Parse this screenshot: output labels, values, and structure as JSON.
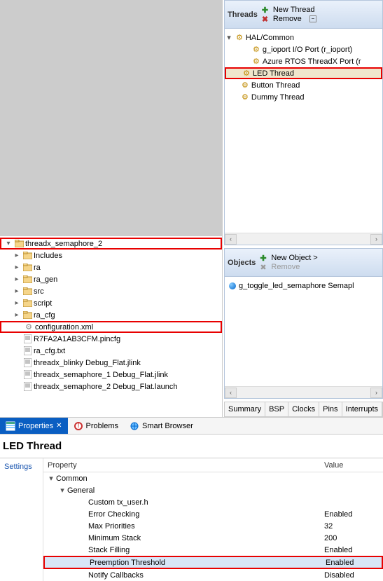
{
  "project_tree": {
    "root": "threadx_semaphore_2",
    "children": [
      {
        "label": "Includes",
        "type": "folder-inc"
      },
      {
        "label": "ra",
        "type": "folder"
      },
      {
        "label": "ra_gen",
        "type": "folder"
      },
      {
        "label": "src",
        "type": "folder"
      },
      {
        "label": "script",
        "type": "folder"
      },
      {
        "label": "ra_cfg",
        "type": "folder"
      },
      {
        "label": "configuration.xml",
        "type": "cfg",
        "hl": true
      },
      {
        "label": "R7FA2A1AB3CFM.pincfg",
        "type": "file"
      },
      {
        "label": "ra_cfg.txt",
        "type": "file"
      },
      {
        "label": "threadx_blinky Debug_Flat.jlink",
        "type": "file"
      },
      {
        "label": "threadx_semaphore_1 Debug_Flat.jlink",
        "type": "file"
      },
      {
        "label": "threadx_semaphore_2 Debug_Flat.launch",
        "type": "file"
      }
    ]
  },
  "threads_panel": {
    "title": "Threads",
    "actions": {
      "new": "New Thread",
      "remove": "Remove"
    },
    "root": "HAL/Common",
    "hal_children": [
      "g_ioport I/O Port (r_ioport)",
      "Azure RTOS ThreadX Port (r"
    ],
    "threads": [
      {
        "label": "LED Thread",
        "hl": true
      },
      {
        "label": "Button Thread"
      },
      {
        "label": "Dummy Thread"
      }
    ]
  },
  "objects_panel": {
    "title": "Objects",
    "actions": {
      "new": "New Object >",
      "remove": "Remove"
    },
    "items": [
      "g_toggle_led_semaphore Semapl"
    ]
  },
  "bottom_tabs": [
    "Summary",
    "BSP",
    "Clocks",
    "Pins",
    "Interrupts"
  ],
  "view_tabs": [
    {
      "label": "Properties",
      "active": true,
      "closable": true
    },
    {
      "label": "Problems"
    },
    {
      "label": "Smart Browser"
    }
  ],
  "properties": {
    "title": "LED Thread",
    "side_tab": "Settings",
    "headers": {
      "prop": "Property",
      "val": "Value"
    },
    "rows": [
      {
        "label": "Common",
        "level": 0,
        "expander": "v"
      },
      {
        "label": "General",
        "level": 1,
        "expander": "v"
      },
      {
        "label": "Custom tx_user.h",
        "level": 2,
        "value": ""
      },
      {
        "label": "Error Checking",
        "level": 2,
        "value": "Enabled"
      },
      {
        "label": "Max Priorities",
        "level": 2,
        "value": "32"
      },
      {
        "label": "Minimum Stack",
        "level": 2,
        "value": "200"
      },
      {
        "label": "Stack Filling",
        "level": 2,
        "value": "Enabled"
      },
      {
        "label": "Preemption Threshold",
        "level": 2,
        "value": "Enabled",
        "sel": true,
        "hl": true
      },
      {
        "label": "Notify Callbacks",
        "level": 2,
        "value": "Disabled"
      }
    ]
  }
}
